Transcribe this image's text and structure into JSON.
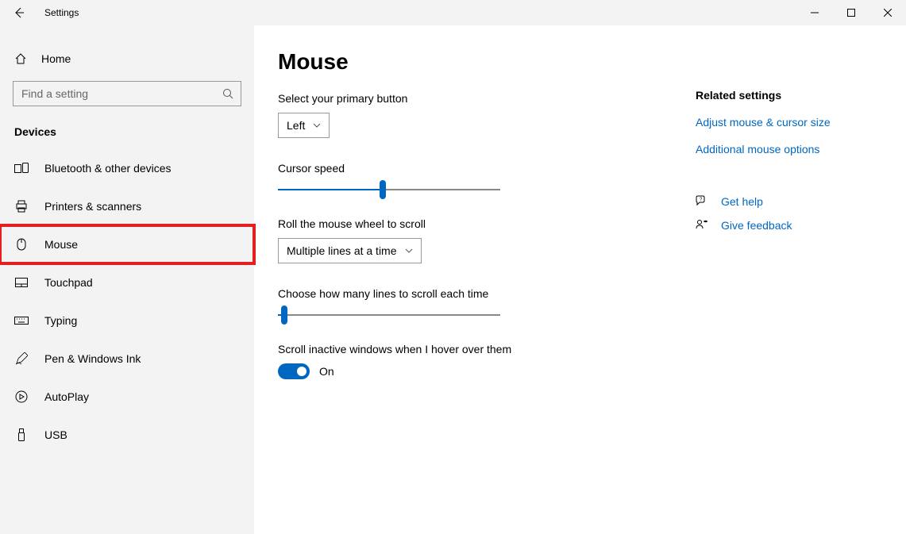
{
  "window": {
    "title": "Settings"
  },
  "sidebar": {
    "home": "Home",
    "search_placeholder": "Find a setting",
    "category": "Devices",
    "items": [
      {
        "label": "Bluetooth & other devices"
      },
      {
        "label": "Printers & scanners"
      },
      {
        "label": "Mouse"
      },
      {
        "label": "Touchpad"
      },
      {
        "label": "Typing"
      },
      {
        "label": "Pen & Windows Ink"
      },
      {
        "label": "AutoPlay"
      },
      {
        "label": "USB"
      }
    ]
  },
  "main": {
    "title": "Mouse",
    "primary_button_label": "Select your primary button",
    "primary_button_value": "Left",
    "cursor_speed_label": "Cursor speed",
    "scroll_mode_label": "Roll the mouse wheel to scroll",
    "scroll_mode_value": "Multiple lines at a time",
    "scroll_lines_label": "Choose how many lines to scroll each time",
    "inactive_label": "Scroll inactive windows when I hover over them",
    "inactive_value": "On",
    "cursor_speed_percent": 47,
    "scroll_lines_percent": 3
  },
  "related": {
    "heading": "Related settings",
    "link1": "Adjust mouse & cursor size",
    "link2": "Additional mouse options",
    "help": "Get help",
    "feedback": "Give feedback"
  }
}
